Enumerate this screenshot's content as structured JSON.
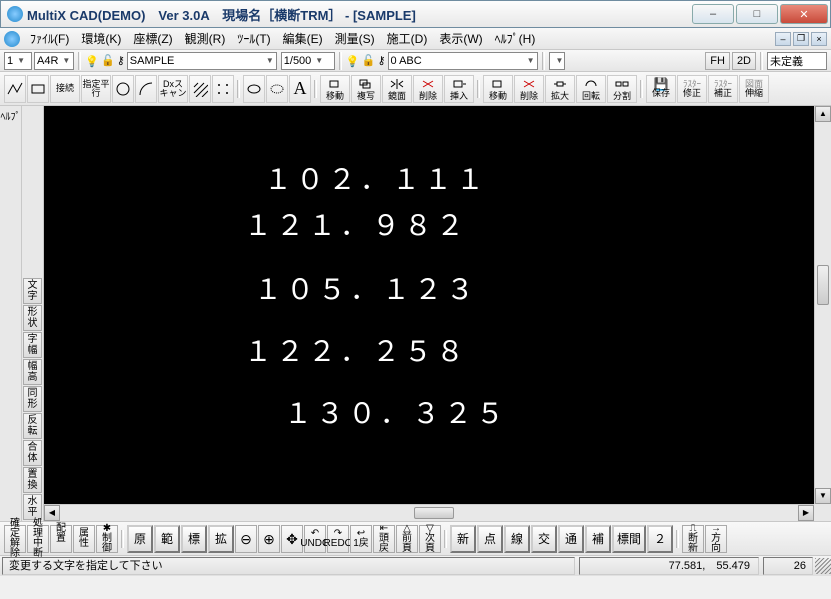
{
  "title": "MultiX CAD(DEMO)　Ver 3.0A　現場名［横断TRM］ - [SAMPLE]",
  "menu": {
    "file": "ﾌｧｲﾙ(F)",
    "env": "環境(K)",
    "coord": "座標(Z)",
    "obs": "観測(R)",
    "tool": "ﾂｰﾙ(T)",
    "edit": "編集(E)",
    "survey": "測量(S)",
    "const": "施工(D)",
    "view": "表示(W)",
    "help": "ﾍﾙﾌﾟ(H)"
  },
  "std": {
    "num1": "1",
    "paper": "A4R",
    "layer_name": "SAMPLE",
    "scale": "1/500",
    "layer2": "0 ABC",
    "fh": "FH",
    "d2": "2D",
    "undef": "未定義"
  },
  "tools": {
    "cont": "接続",
    "para": "指定平行",
    "scan": "Dxスキャン",
    "g_move": "移動",
    "g_copy": "複写",
    "g_mirror": "鏡面",
    "g_del": "削除",
    "g_ins": "挿入",
    "l_move": "移動",
    "l_del": "削除",
    "l_zoom": "拡大",
    "l_rot": "回転",
    "l_split": "分割",
    "r_save": "保存",
    "r_fix": "修正",
    "r_comp": "補正",
    "r_ext": "伸縮",
    "r_lbl1": "ﾗｽﾀｰ",
    "r_lbl2": "ﾗｽﾀｰ",
    "r_lbl3": "図面"
  },
  "help_label": "ﾍﾙﾌﾟ",
  "props": [
    "文字",
    "形状",
    "字幅",
    "幅高",
    "同形",
    "反転",
    "合体",
    "置換",
    "水平"
  ],
  "canvas_text": [
    "１０２．１１１",
    "１２１．９８２",
    "１０５．１２３",
    "１２２．２５８",
    "１３０．３２５"
  ],
  "cmd": {
    "kakutei": "確定",
    "kaijo": "解除",
    "shori": "処理",
    "chudan": "中断",
    "haichi": "配置",
    "zoku": "属",
    "sei": "性",
    "seigyo": "制御",
    "gen": "原",
    "han": "範",
    "hyo": "標",
    "kaku": "拡",
    "undo": "UNDO",
    "redo": "REDO",
    "ichimodo": "1戻",
    "zumodo": "頭戻",
    "zenga": "前頁",
    "jiga": "次頁",
    "shin": "新",
    "ten": "点",
    "sen": "線",
    "ko": "交",
    "tsu": "通",
    "ho": "補",
    "hyoma": "標間",
    "ni": "２",
    "dansa": "断新",
    "houkou": "方向"
  },
  "status": {
    "msg": "変更する文字を指定して下さい",
    "x": "77.581,",
    "y": "55.479",
    "n": "26"
  }
}
